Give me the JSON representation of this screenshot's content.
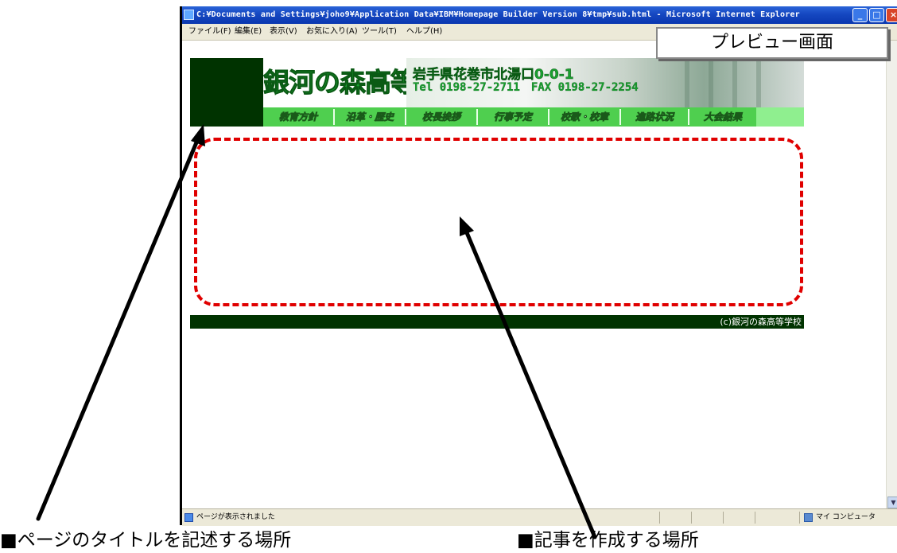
{
  "window": {
    "title": "C:¥Documents and Settings¥joho9¥Application Data¥IBM¥Homepage Builder Version 8¥tmp¥sub.html - Microsoft Internet Explorer",
    "buttons": {
      "minimize": "_",
      "maximize": "□",
      "close": "×"
    }
  },
  "menubar": {
    "items": [
      {
        "label": "ファイル(F)"
      },
      {
        "label": "編集(E)"
      },
      {
        "label": "表示(V)"
      },
      {
        "label": "お気に入り(A)"
      },
      {
        "label": "ツール(T)"
      },
      {
        "label": "ヘルプ(H)"
      }
    ]
  },
  "preview_label": "プレビュー画面",
  "site": {
    "school_name": "銀河の森高等学校",
    "address": "岩手県花巻市北湯口0-0-1",
    "contact": "Tel 0198-27-2711　FAX 0198-27-2254",
    "nav": [
      {
        "label": "教育方針"
      },
      {
        "label": "沿革・歴史"
      },
      {
        "label": "校長挨拶"
      },
      {
        "label": "行事予定"
      },
      {
        "label": "校歌・校章"
      },
      {
        "label": "進路状況"
      },
      {
        "label": "大会結果"
      }
    ],
    "footer": "(c)銀河の森高等学校"
  },
  "statusbar": {
    "status": "ページが表示されました",
    "zone": "マイ コンピュータ"
  },
  "annotations": {
    "title_area": "■ページのタイトルを記述する場所",
    "article_area": "■記事を作成する場所"
  },
  "colors": {
    "title_bar": "#0a37b0",
    "dark_green": "#003300",
    "nav_green": "#4fcf4f",
    "accent_green": "#19a030",
    "dashed_region": "#e00000"
  }
}
